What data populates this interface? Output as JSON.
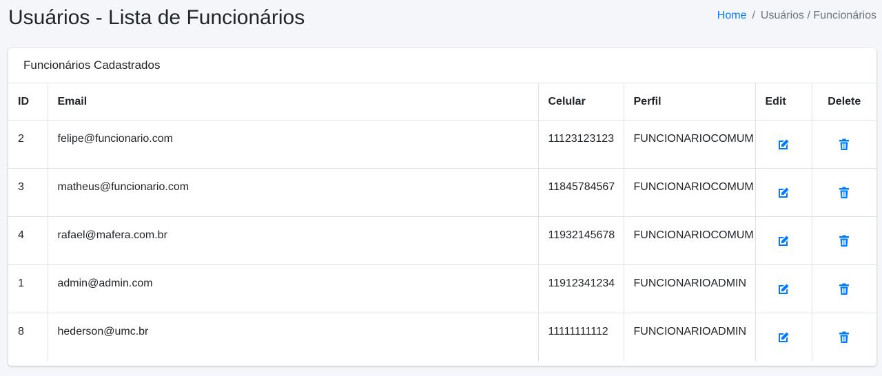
{
  "header": {
    "title": "Usuários - Lista de Funcionários",
    "breadcrumb": {
      "home": "Home",
      "separator": "/",
      "current": "Usuários / Funcionários"
    }
  },
  "card": {
    "title": "Funcionários Cadastrados",
    "columns": {
      "id": "ID",
      "email": "Email",
      "celular": "Celular",
      "perfil": "Perfil",
      "edit": "Edit",
      "delete": "Delete"
    },
    "rows": [
      {
        "id": "2",
        "email": "felipe@funcionario.com",
        "celular": "11123123123",
        "perfil": "FUNCIONARIOCOMUM"
      },
      {
        "id": "3",
        "email": "matheus@funcionario.com",
        "celular": "11845784567",
        "perfil": "FUNCIONARIOCOMUM"
      },
      {
        "id": "4",
        "email": "rafael@mafera.com.br",
        "celular": "11932145678",
        "perfil": "FUNCIONARIOCOMUM"
      },
      {
        "id": "1",
        "email": "admin@admin.com",
        "celular": "11912341234",
        "perfil": "FUNCIONARIOADMIN"
      },
      {
        "id": "8",
        "email": "hederson@umc.br",
        "celular": "11111111112",
        "perfil": "FUNCIONARIOADMIN"
      }
    ]
  },
  "icons": {
    "edit": "edit-icon",
    "delete": "trash-icon"
  },
  "colors": {
    "accent": "#007bff",
    "background": "#f4f6f9",
    "border": "#dee2e6"
  }
}
